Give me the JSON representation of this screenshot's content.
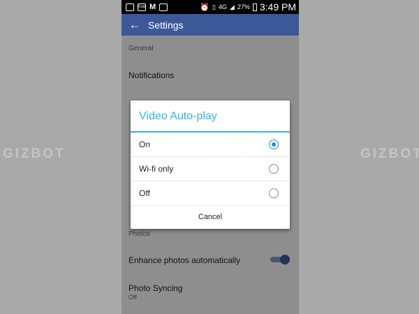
{
  "status_bar": {
    "icons": [
      "image-icon",
      "app-badge-icon",
      "m-app-icon",
      "camera-icon",
      "alarm-icon",
      "vibrate-icon",
      "network-4g-icon",
      "signal-icon",
      "battery-icon"
    ],
    "app_badge_text": "true",
    "network_text": "4G",
    "battery_percent": "27%",
    "time": "3:49 PM"
  },
  "toolbar": {
    "title": "Settings"
  },
  "settings": {
    "general_header": "General",
    "notifications_label": "Notifications",
    "photos_header": "Photos",
    "enhance_label": "Enhance photos automatically",
    "enhance_enabled": true,
    "photo_syncing_label": "Photo Syncing",
    "photo_syncing_value": "Off"
  },
  "dialog": {
    "title": "Video Auto-play",
    "options": [
      {
        "label": "On",
        "selected": true
      },
      {
        "label": "Wi-fi only",
        "selected": false
      },
      {
        "label": "Off",
        "selected": false
      }
    ],
    "cancel_label": "Cancel"
  },
  "watermark": {
    "text": "GIZBOT"
  },
  "colors": {
    "toolbar": "#3b5998",
    "accent": "#33b5e5",
    "radio_selected": "#1a8fd6"
  }
}
